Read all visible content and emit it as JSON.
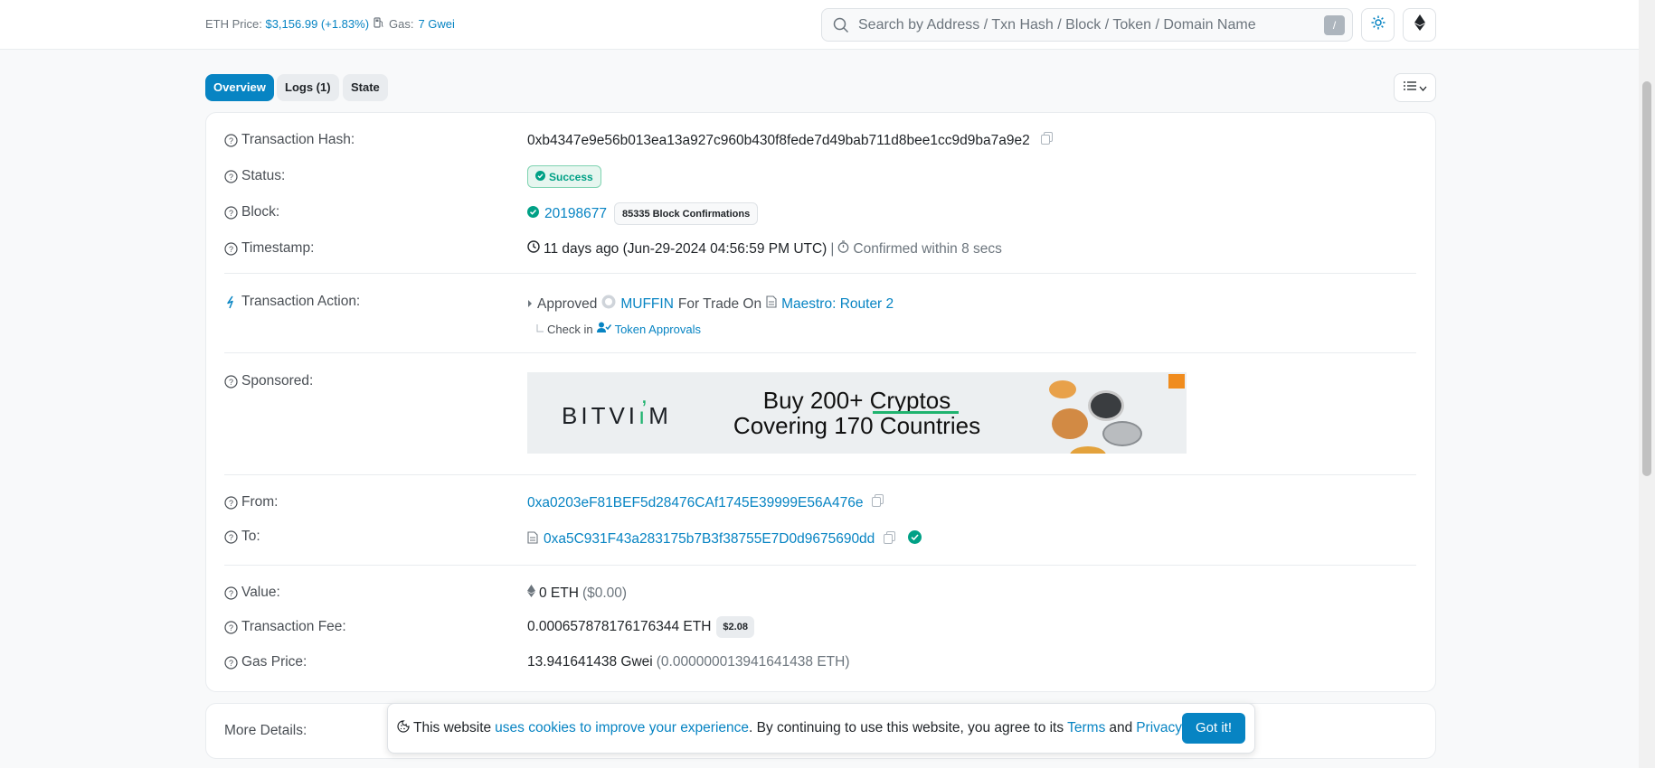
{
  "header": {
    "eth_price_label": "ETH Price:",
    "eth_price_value": "$3,156.99 (+1.83%)",
    "gas_label": "Gas:",
    "gas_value": "7 Gwei",
    "search_placeholder": "Search by Address / Txn Hash / Block / Token / Domain Name",
    "search_shortcut": "/"
  },
  "tabs": [
    {
      "label": "Overview",
      "active": true
    },
    {
      "label": "Logs (1)",
      "active": false
    },
    {
      "label": "State",
      "active": false
    }
  ],
  "details": {
    "tx_hash_label": "Transaction Hash:",
    "tx_hash": "0xb4347e9e56b013ea13a927c960b430f8fede7d49bab711d8bee1cc9d9ba7a9e2",
    "status_label": "Status:",
    "status": "Success",
    "block_label": "Block:",
    "block": "20198677",
    "confirmations": "85335 Block Confirmations",
    "timestamp_label": "Timestamp:",
    "timestamp": "11 days ago (Jun-29-2024 04:56:59 PM UTC)",
    "timestamp_sep": "|",
    "confirmed_within": "Confirmed within 8 secs",
    "action_label": "Transaction Action:",
    "action_approved": "Approved",
    "action_token": "MUFFIN",
    "action_for_trade": "For Trade On",
    "action_router": "Maestro: Router 2",
    "action_check_in": "Check in",
    "action_token_approvals": "Token Approvals",
    "sponsored_label": "Sponsored:",
    "from_label": "From:",
    "from": "0xa0203eF81BEF5d28476CAf1745E39999E56A476e",
    "to_label": "To:",
    "to": "0xa5C931F43a283175b7B3f38755E7D0d9675690dd",
    "value_label": "Value:",
    "value": "0 ETH",
    "value_usd": "($0.00)",
    "fee_label": "Transaction Fee:",
    "fee": "0.000657878176176344 ETH",
    "fee_usd": "$2.08",
    "gas_price_label": "Gas Price:",
    "gas_price": "13.941641438 Gwei",
    "gas_price_eth": "(0.000000013941641438 ETH)"
  },
  "ad": {
    "brand": "BITVI",
    "brand_end": "M",
    "line1": "Buy 200+ Cryptos",
    "line2": "Covering 170 Countries"
  },
  "more_details_label": "More Details:",
  "cookie": {
    "text1": "This website",
    "link1": "uses cookies to improve your experience",
    "text2": ". By continuing to use this website, you agree to its",
    "link2": "Terms",
    "text3": "and",
    "link3": "Privacy Policy",
    "text4": ".",
    "button": "Got it!"
  },
  "colors": {
    "link": "#0784c3",
    "success": "#00a186",
    "background": "#f8f9fa"
  }
}
